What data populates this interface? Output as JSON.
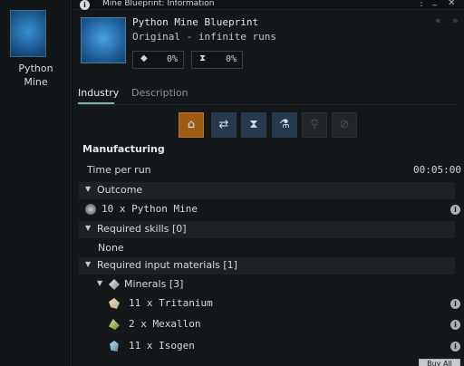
{
  "left_panel": {
    "item_label": "Python\nMine",
    "thumb_icon": "python-mine-icon"
  },
  "window": {
    "title": "Mine Blueprint: Information",
    "menu_icon": "⋮",
    "minimize_icon": "_",
    "close_icon": "✕"
  },
  "header": {
    "name": "Python Mine Blueprint",
    "subtitle": "Original - infinite runs",
    "me_icon": "gem-icon",
    "me_value": "0%",
    "te_icon": "hourglass-icon",
    "te_value": "0%",
    "back_icon": "«",
    "forward_icon": "»"
  },
  "tabs": [
    {
      "label": "Industry",
      "active": true
    },
    {
      "label": "Description",
      "active": false
    }
  ],
  "activities": [
    {
      "name": "manufacturing",
      "icon": "factory-icon",
      "active": true
    },
    {
      "name": "copying",
      "icon": "copy-icon",
      "active": false
    },
    {
      "name": "time-efficiency",
      "icon": "time-efficiency-icon",
      "active": false
    },
    {
      "name": "material-efficiency",
      "icon": "flask-icon",
      "active": false
    },
    {
      "name": "invention",
      "icon": "microscope-icon",
      "active": false,
      "disabled": true
    },
    {
      "name": "reactions",
      "icon": "reaction-icon",
      "active": false,
      "disabled": true
    }
  ],
  "manufacturing": {
    "title": "Manufacturing",
    "time_label": "Time per run",
    "time_value": "00:05:00",
    "outcome_label": "Outcome",
    "outcome_item": "10 x Python Mine",
    "skills_label": "Required skills [0]",
    "skills_none": "None",
    "materials_label": "Required input materials [1]",
    "minerals_label": "Minerals [3]",
    "minerals": [
      {
        "text": "11 x Tritanium",
        "icon": "tritanium-icon"
      },
      {
        "text": "2 x Mexallon",
        "icon": "mexallon-icon"
      },
      {
        "text": "11 x Isogen",
        "icon": "isogen-icon"
      }
    ]
  },
  "footer": {
    "price_all_label": "Buy All"
  },
  "colors": {
    "accent_orange": "#a05c14",
    "tab_underline": "#7fb3a6",
    "activity_blue": "#26394e"
  }
}
